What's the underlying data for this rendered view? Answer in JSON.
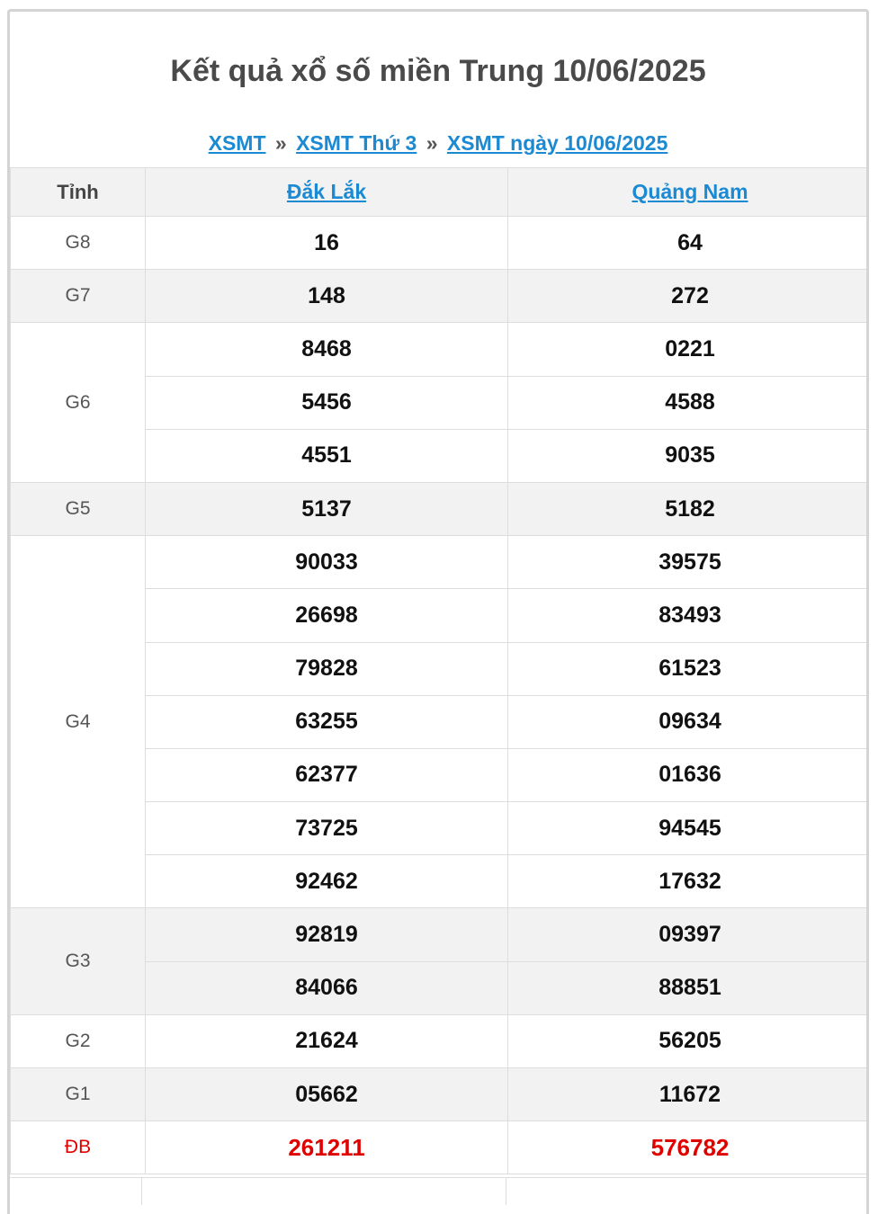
{
  "page_title": "Kết quả xổ số miền Trung 10/06/2025",
  "breadcrumb": {
    "items": [
      "XSMT",
      "XSMT Thứ 3",
      "XSMT ngày 10/06/2025"
    ],
    "separator": "»"
  },
  "table": {
    "header": {
      "prize": "Tỉnh",
      "provinces": [
        "Đắk Lắk",
        "Quảng Nam"
      ]
    },
    "prizes": [
      {
        "label": "G8",
        "rows": [
          [
            "16",
            "64"
          ]
        ]
      },
      {
        "label": "G7",
        "rows": [
          [
            "148",
            "272"
          ]
        ]
      },
      {
        "label": "G6",
        "rows": [
          [
            "8468",
            "0221"
          ],
          [
            "5456",
            "4588"
          ],
          [
            "4551",
            "9035"
          ]
        ]
      },
      {
        "label": "G5",
        "rows": [
          [
            "5137",
            "5182"
          ]
        ]
      },
      {
        "label": "G4",
        "rows": [
          [
            "90033",
            "39575"
          ],
          [
            "26698",
            "83493"
          ],
          [
            "79828",
            "61523"
          ],
          [
            "63255",
            "09634"
          ],
          [
            "62377",
            "01636"
          ],
          [
            "73725",
            "94545"
          ],
          [
            "92462",
            "17632"
          ]
        ]
      },
      {
        "label": "G3",
        "rows": [
          [
            "92819",
            "09397"
          ],
          [
            "84066",
            "88851"
          ]
        ]
      },
      {
        "label": "G2",
        "rows": [
          [
            "21624",
            "56205"
          ]
        ]
      },
      {
        "label": "G1",
        "rows": [
          [
            "05662",
            "11672"
          ]
        ]
      },
      {
        "label": "ĐB",
        "rows": [
          [
            "261211",
            "576782"
          ]
        ]
      }
    ]
  },
  "colors": {
    "link": "#1b8ad3",
    "special": "#e00000",
    "stripe": "#f2f2f2"
  }
}
